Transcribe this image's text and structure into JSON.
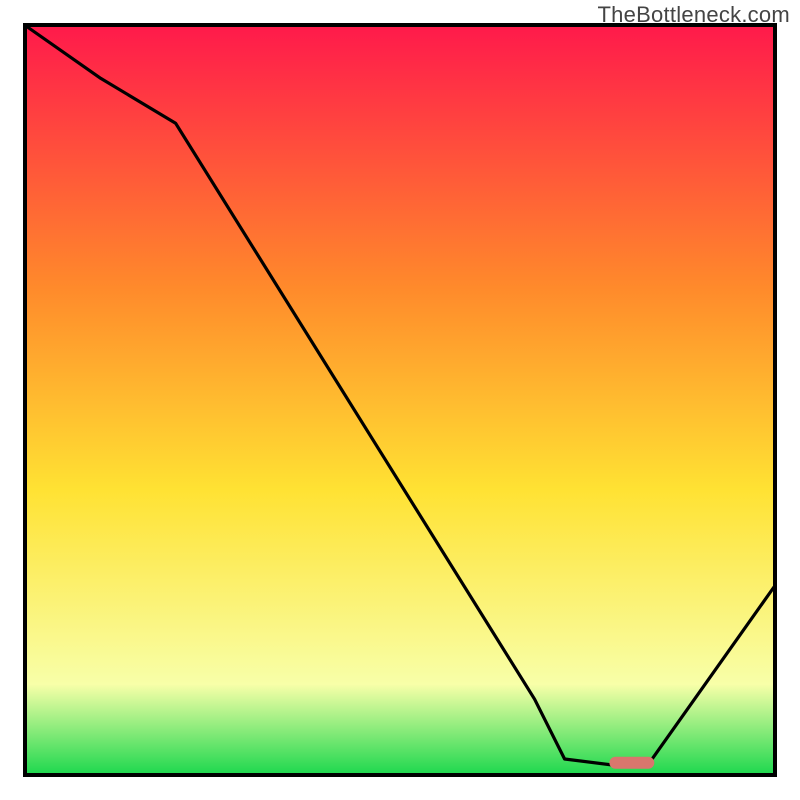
{
  "watermark": "TheBottleneck.com",
  "chart_data": {
    "type": "line",
    "title": "",
    "xlabel": "",
    "ylabel": "",
    "xlim": [
      0,
      100
    ],
    "ylim": [
      0,
      100
    ],
    "x": [
      0,
      10,
      20,
      68,
      72,
      80,
      83,
      100
    ],
    "values": [
      100,
      93,
      87,
      10,
      2,
      1,
      1,
      25
    ],
    "marker": {
      "x_start": 78,
      "x_end": 84,
      "y": 1.5
    },
    "colors": {
      "gradient_top": "#ff1a4b",
      "gradient_mid_high": "#ff8a2b",
      "gradient_mid": "#ffe233",
      "gradient_low": "#f8ffa8",
      "gradient_bottom": "#1fd84f",
      "line": "#000000",
      "marker": "#d9766d",
      "frame": "#000000"
    }
  }
}
